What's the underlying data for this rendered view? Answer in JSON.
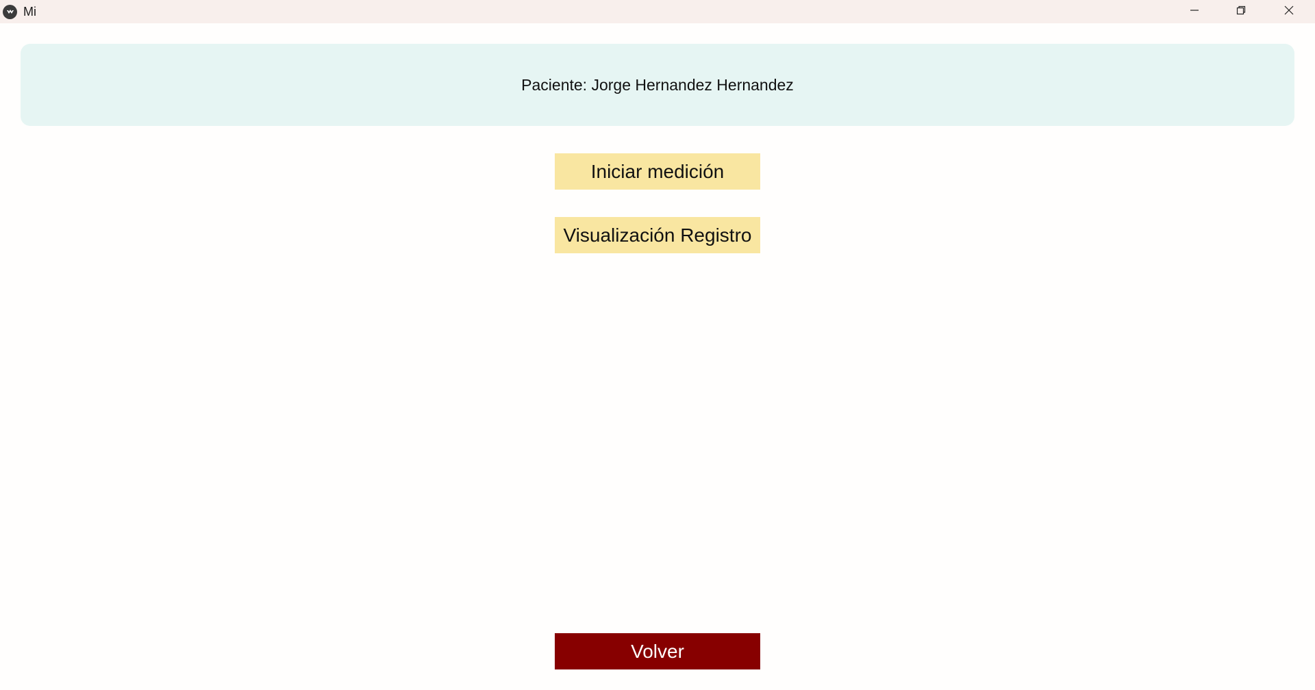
{
  "window": {
    "title": "Mi",
    "icon": "kivy-logo-icon",
    "controls": {
      "minimize": "minimize-icon",
      "maximize": "restore-icon",
      "close": "close-icon"
    }
  },
  "header": {
    "patient_label": "Paciente: Jorge Hernandez Hernandez"
  },
  "actions": {
    "start_measurement": "Iniciar medición",
    "view_records": "Visualización Registro"
  },
  "footer": {
    "back_label": "Volver"
  },
  "colors": {
    "titlebar": "#f8efec",
    "panel": "#e6f5f3",
    "action_button": "#f9e6a1",
    "back_button": "#870000"
  }
}
